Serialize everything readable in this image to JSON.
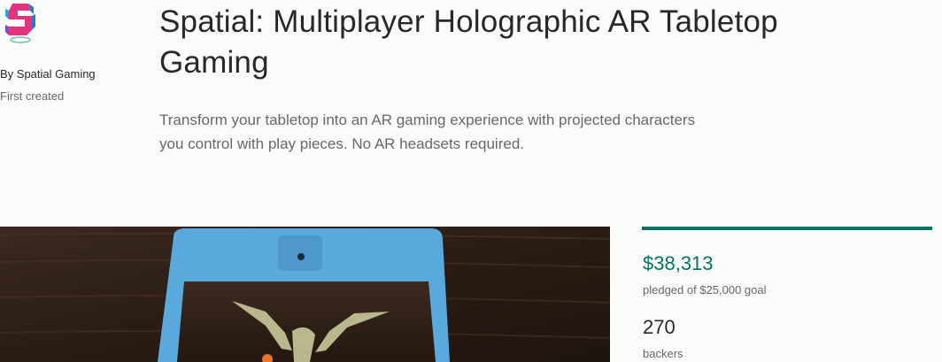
{
  "creator": {
    "by_label": "By Spatial Gaming",
    "first_created_label": "First created"
  },
  "project": {
    "title": "Spatial: Multiplayer Holographic AR Tabletop Gaming",
    "blurb": "Transform your tabletop into an AR gaming experience with projected characters you control with play pieces. No AR headsets required."
  },
  "stats": {
    "pledged_amount": "$38,313",
    "pledged_label": "pledged of $25,000 goal",
    "backers_count": "270",
    "backers_label": "backers",
    "progress_fraction": 1.0
  },
  "colors": {
    "accent": "#037362",
    "text": "#282828",
    "muted": "#656969",
    "device_blue": "#5aa9dd"
  },
  "icons": {
    "logo": "spatial-s-logo-icon"
  }
}
